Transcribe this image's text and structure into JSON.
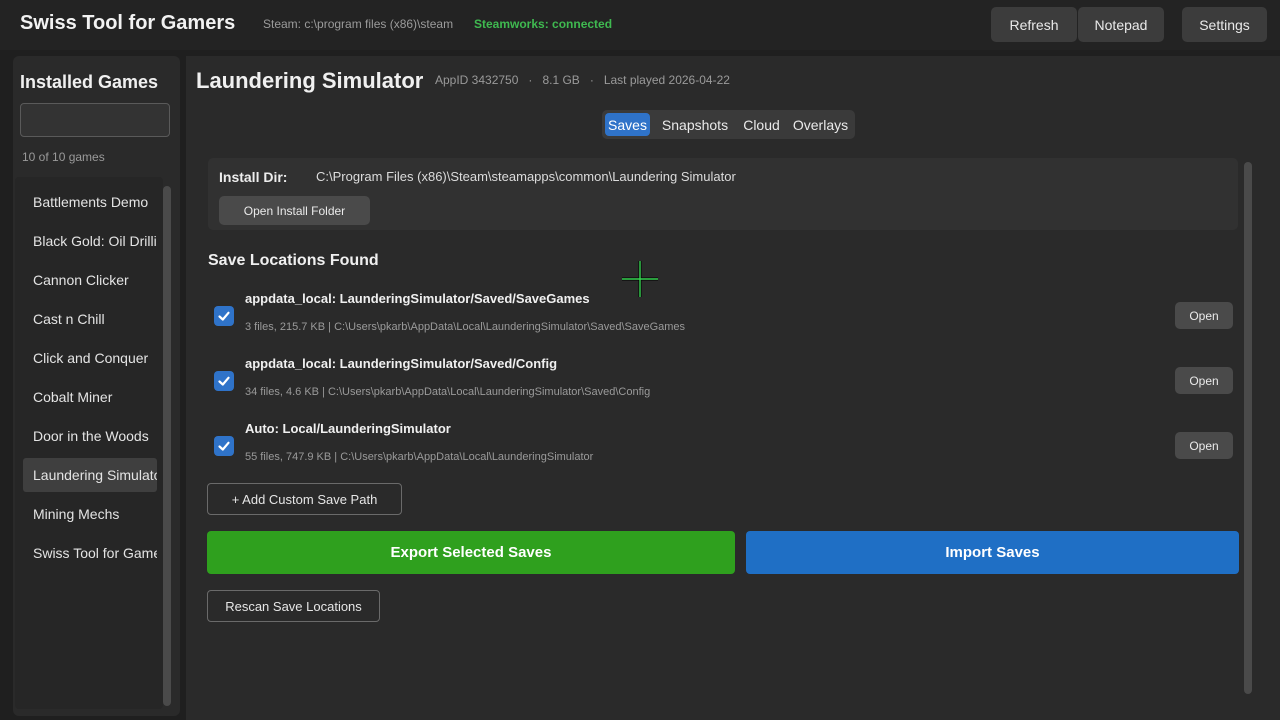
{
  "header": {
    "app_title": "Swiss Tool for Gamers",
    "steam_path": "Steam: c:\\program files (x86)\\steam",
    "steamworks_status": "Steamworks: connected",
    "buttons": {
      "refresh": "Refresh",
      "notepad": "Notepad",
      "settings": "Settings"
    }
  },
  "sidebar": {
    "title": "Installed Games",
    "search_value": "",
    "count": "10 of 10 games",
    "games": [
      "Battlements Demo",
      "Black Gold: Oil Drilling",
      "Cannon Clicker",
      "Cast n Chill",
      "Click and Conquer",
      "Cobalt Miner",
      "Door in the Woods",
      "Laundering Simulator",
      "Mining Mechs",
      "Swiss Tool for Gamers"
    ],
    "selected": "Laundering Simulator"
  },
  "main": {
    "game_title": "Laundering Simulator",
    "meta": {
      "appid": "AppID 3432750",
      "size": "8.1 GB",
      "last_played": "Last played 2026-04-22",
      "separator": "·"
    },
    "tabs": [
      "Saves",
      "Snapshots",
      "Cloud",
      "Overlays"
    ],
    "active_tab": "Saves",
    "install": {
      "label": "Install Dir:",
      "path": "C:\\Program Files (x86)\\Steam\\steamapps\\common\\Laundering Simulator",
      "open_button": "Open Install Folder"
    },
    "section_title": "Save Locations Found",
    "save_locations": [
      {
        "name": "appdata_local: LaunderingSimulator/Saved/SaveGames",
        "info": "3 files, 215.7 KB  |  C:\\Users\\pkarb\\AppData\\Local\\LaunderingSimulator\\Saved\\SaveGames",
        "checked": true,
        "open_label": "Open"
      },
      {
        "name": "appdata_local: LaunderingSimulator/Saved/Config",
        "info": "34 files, 4.6 KB  |  C:\\Users\\pkarb\\AppData\\Local\\LaunderingSimulator\\Saved\\Config",
        "checked": true,
        "open_label": "Open"
      },
      {
        "name": "Auto: Local/LaunderingSimulator",
        "info": "55 files, 747.9 KB  |  C:\\Users\\pkarb\\AppData\\Local\\LaunderingSimulator",
        "checked": true,
        "open_label": "Open"
      }
    ],
    "add_custom_path": "+ Add Custom Save Path",
    "export_button": "Export Selected Saves",
    "import_button": "Import Saves",
    "rescan_button": "Rescan Save Locations"
  },
  "colors": {
    "accent_blue": "#2f73c9",
    "export_green": "#2fa01e",
    "import_blue": "#1f6fc5",
    "connected_green": "#3fb950"
  }
}
